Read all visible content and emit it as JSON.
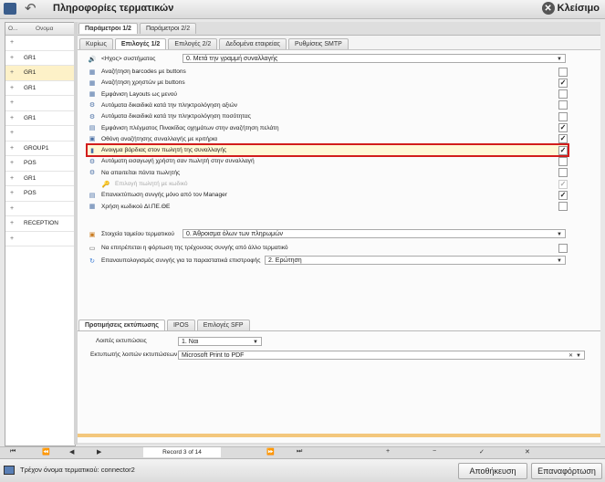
{
  "window": {
    "title": "Πληροφορίες τερματικών",
    "close_label": "Κλείσιμο"
  },
  "left_grid": {
    "columns": [
      "Ο...",
      "Ονομα"
    ],
    "rows": [
      {
        "name": "",
        "expand": "+"
      },
      {
        "name": "GR1",
        "expand": "+"
      },
      {
        "name": "GR1",
        "expand": "+"
      },
      {
        "name": "GR1",
        "expand": "+"
      },
      {
        "name": "",
        "expand": "+"
      },
      {
        "name": "GR1",
        "expand": "+"
      },
      {
        "name": "",
        "expand": "+"
      },
      {
        "name": "GROUP1",
        "expand": "+"
      },
      {
        "name": "POS",
        "expand": "+"
      },
      {
        "name": "GR1",
        "expand": "+"
      },
      {
        "name": "POS",
        "expand": "+"
      },
      {
        "name": "",
        "expand": "+"
      },
      {
        "name": "RECEPTION",
        "expand": "+"
      },
      {
        "name": "",
        "expand": "+"
      }
    ]
  },
  "top_tabs": [
    "Παράμετροι 1/2",
    "Παράμετροι 2/2"
  ],
  "sub_tabs": [
    "Κυρίως",
    "Επιλογές 1/2",
    "Επιλογές 2/2",
    "Δεδομένα εταιρείας",
    "Ρυθμίσεις SMTP"
  ],
  "options": {
    "sound_label": "<Ηχος> συστήματος",
    "sound_value": "0. Μετά την γραμμή συναλλαγής",
    "items": [
      {
        "label": "Αναζήτηση barcodes με buttons",
        "checked": false
      },
      {
        "label": "Αναζήτηση χρηστών με buttons",
        "checked": true
      },
      {
        "label": "Εμφάνιση Layouts ως μενού",
        "checked": false
      },
      {
        "label": "Αυτόματα δικαιδικά κατά την πληκτρολόγηση αξιών",
        "checked": false
      },
      {
        "label": "Αυτόματα δικαιδικά κατά την πληκτρολόγηση ποσότητας",
        "checked": false
      },
      {
        "label": "Εμφάνιση πλέγματος Πινακίδας οχημάτων στην αναζήτηση πελάτη",
        "checked": true
      },
      {
        "label": "Οθόνη αναζήτησης συναλλαγής με κριτήρια",
        "checked": true
      },
      {
        "label": "Ανοιγμα βάρδιας στον πωλητή της συναλλαγής",
        "checked": true
      },
      {
        "label": "Αυτόματη εισαγωγή χρήστη σαν πωλητή στην συναλλαγή",
        "checked": false
      },
      {
        "label": "Να απαιτείται πάντα πωλητής",
        "checked": false
      },
      {
        "label": "Επιλογή πωλητή με κωδικό",
        "checked": true,
        "disabled": true
      },
      {
        "label": "Επανεκτύπωση συνγής μόνο από τον Manager",
        "checked": true
      },
      {
        "label": "Χρήση κωδικού ΔΙ.ΠΕ.ΘΕ",
        "checked": false
      }
    ],
    "cash_label": "Στοιχεία ταμείου τερματικού",
    "cash_value": "0. Άθροισμα όλων των πληρωμών",
    "allow_label": "Να επιτρέπεται η φόρτωση της τρέχουσας συνγής από άλλο τερματικό",
    "allow_checked": false,
    "recalc_label": "Επαναυπολογισμός συνγής για τα παραστατικά επιστροφής",
    "recalc_value": "2. Ερώτηση"
  },
  "print_tabs": [
    "Προτιμήσεις εκτύπωσης",
    "IPOS",
    "Επιλογές SFP"
  ],
  "print": {
    "other_printers_label": "Λοιπές εκτυπώσεις",
    "other_printers_value": "1. Ναι",
    "printer_label": "Εκτυπωτής λοιπών εκτυπώσεων",
    "printer_value": "Microsoft Print to PDF"
  },
  "navigator": {
    "record": "Record 3 of 14",
    "buttons": [
      "⏮",
      "⏪",
      "◀",
      "▶",
      "⏩",
      "⏭",
      "+",
      "−",
      "✓",
      "✕"
    ]
  },
  "status": {
    "terminal_text": "Τρέχον όνομα τερματικού: connector2",
    "save_label": "Αποθήκευση",
    "reload_label": "Επαναφόρτωση"
  },
  "colors": {
    "highlight": "#d21d1d",
    "selected_row": "#fdf1c8"
  }
}
